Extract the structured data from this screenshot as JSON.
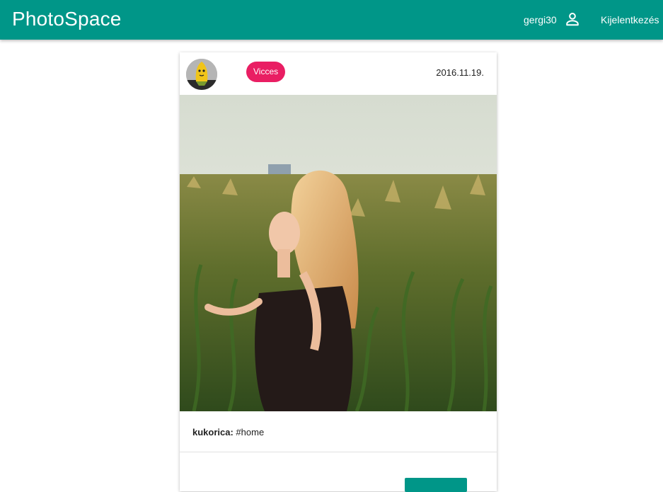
{
  "app": {
    "brand": "PhotoSpace",
    "username": "gergi30",
    "logout_label": "Kijelentkezés",
    "accent_color": "#009688",
    "user_icon": "account-icon"
  },
  "post": {
    "category": "Vicces",
    "category_color": "#e91e63",
    "date": "2016.11.19.",
    "author_avatar": "corn-avatar",
    "caption_title": "kukorica:",
    "caption_text": " #home"
  }
}
